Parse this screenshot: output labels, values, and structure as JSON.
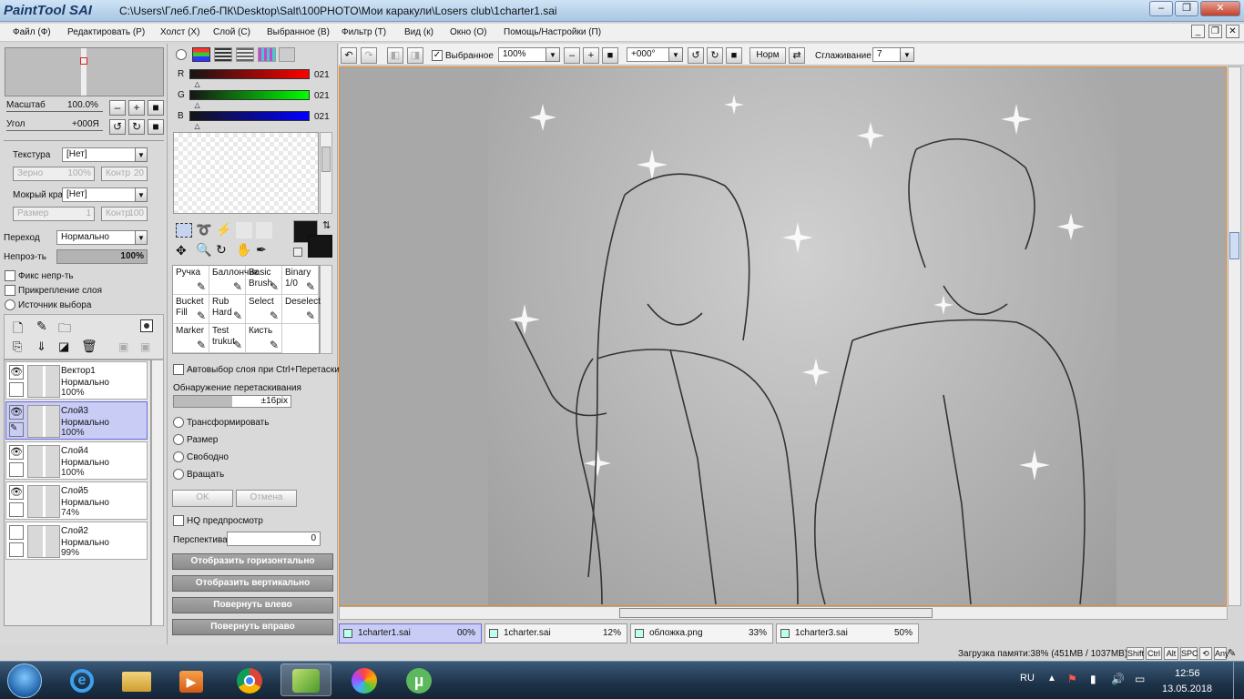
{
  "title": {
    "logo": "PaintTool SAI",
    "path": "C:\\Users\\Глеб.Глеб-ПК\\Desktop\\Salt\\100PHOTO\\Мои каракули\\Losers club\\1charter1.sai",
    "minimize": "–",
    "maximize": "❐",
    "close": "✕"
  },
  "menu": [
    "Файл (Ф)",
    "Редактировать (Р)",
    "Холст (Х)",
    "Слой (С)",
    "Выбранное (В)",
    "Фильтр (Т)",
    "Вид (к)",
    "Окно (О)",
    "Помощь/Настройки (П)"
  ],
  "navigator": {
    "scale_label": "Масштаб",
    "scale_value": "100.0%",
    "angle_label": "Угол",
    "angle_value": "+000Я"
  },
  "brush_settings": {
    "texture_label": "Текстура",
    "texture_value": "[Нет]",
    "grain_label": "Зерно",
    "grain_value": "100%",
    "contrast_label": "Контр",
    "contrast_value": "20",
    "wet_label": "Мокрый край",
    "wet_value": "[Нет]",
    "size_label": "Размер",
    "size_value": "1",
    "contrast2_label": "Контр",
    "contrast2_value": "100"
  },
  "layer_props": {
    "blend_label": "Переход",
    "blend_value": "Нормально",
    "opacity_label": "Непроз-ть",
    "opacity_value": "100%",
    "opacity_fraction": 1.0,
    "preserve_opacity": "Фикс непр-ть",
    "clipping": "Прикрепление слоя",
    "selection_source": "Источник выбора"
  },
  "layers": [
    {
      "name": "Вектор1",
      "mode": "Нормально",
      "opacity": "100%",
      "visible": true,
      "selected": false
    },
    {
      "name": "Слой3",
      "mode": "Нормально",
      "opacity": "100%",
      "visible": true,
      "selected": true
    },
    {
      "name": "Слой4",
      "mode": "Нормально",
      "opacity": "100%",
      "visible": true,
      "selected": false
    },
    {
      "name": "Слой5",
      "mode": "Нормально",
      "opacity": "74%",
      "visible": true,
      "selected": false
    },
    {
      "name": "Слой2",
      "mode": "Нормально",
      "opacity": "99%",
      "visible": false,
      "selected": false
    }
  ],
  "color": {
    "r_label": "R",
    "r_value": "021",
    "g_label": "G",
    "g_value": "021",
    "b_label": "B",
    "b_value": "021",
    "r_fraction": 0.08,
    "g_fraction": 0.08,
    "b_fraction": 0.08,
    "primary": "#151515",
    "secondary": "#ffffff"
  },
  "tools": [
    {
      "label": "Ручка",
      "icon": "pen-icon"
    },
    {
      "label": "Баллончик",
      "icon": "airbrush-icon"
    },
    {
      "label": "Basic Brush",
      "icon": "brush-icon"
    },
    {
      "label": "Binary 1/0",
      "icon": "binary-pen-icon"
    },
    {
      "label": "Bucket Fill",
      "icon": "bucket-icon"
    },
    {
      "label": "Rub Hard",
      "icon": "eraser-icon"
    },
    {
      "label": "Select",
      "icon": "select-brush-icon"
    },
    {
      "label": "Deselect",
      "icon": "deselect-brush-icon"
    },
    {
      "label": "Marker",
      "icon": "marker-icon"
    },
    {
      "label": "Test trukut",
      "icon": "test-brush-icon"
    },
    {
      "label": "Кисть",
      "icon": "brush2-icon"
    }
  ],
  "transform": {
    "auto_select": "Автовыбор слоя при Ctrl+Перетаскивании",
    "drag_detect": "Обнаружение перетаскивания",
    "drag_value": "±16pix",
    "options": [
      "Трансформировать",
      "Размер",
      "Свободно",
      "Вращать"
    ],
    "ok": "OK",
    "cancel": "Отмена",
    "hq": "HQ предпросмотр",
    "perspective_label": "Перспектива",
    "perspective_value": "0",
    "flip_h": "Отобразить горизонтально",
    "flip_v": "Отобразить вертикально",
    "rot_left": "Повернуть влево",
    "rot_right": "Повернуть вправо"
  },
  "toolbar": {
    "selection_label": "Выбранное",
    "zoom_value": "100%",
    "angle_value": "+000°",
    "norm_label": "Норм",
    "smoothing_label": "Сглаживание",
    "smoothing_value": "7"
  },
  "tabs": [
    {
      "name": "1charter1.sai",
      "percent": "00%",
      "active": true
    },
    {
      "name": "1charter.sai",
      "percent": "12%",
      "active": false
    },
    {
      "name": "обложка.png",
      "percent": "33%",
      "active": false
    },
    {
      "name": "1charter3.sai",
      "percent": "50%",
      "active": false
    }
  ],
  "status": {
    "memory": "Загрузка памяти:38% (451MB / 1037MB)",
    "keys": [
      "Shift",
      "Ctrl",
      "Alt",
      "SPC",
      "Any"
    ]
  },
  "taskbar": {
    "lang": "RU",
    "time": "12:56",
    "date": "13.05.2018",
    "apps": [
      "start-orb-icon",
      "internet-explorer-icon",
      "file-explorer-icon",
      "media-player-icon",
      "chrome-icon",
      "painttool-sai-icon",
      "color-app-icon",
      "utorrent-icon"
    ]
  }
}
